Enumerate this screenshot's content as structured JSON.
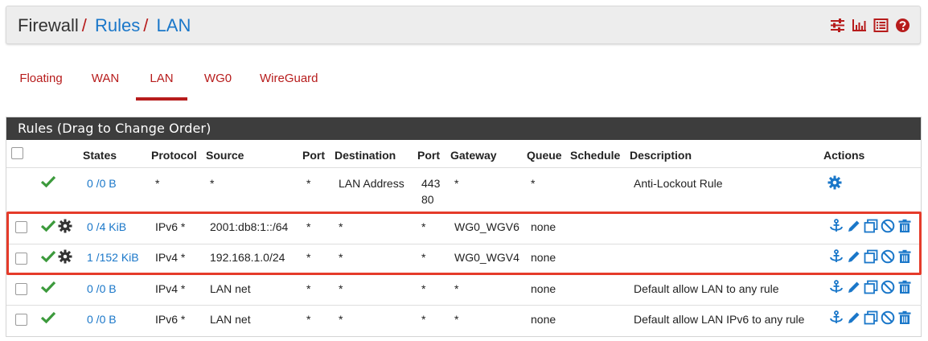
{
  "breadcrumb": {
    "item1": "Firewall",
    "sep1": "/",
    "item2": "Rules",
    "sep2": "/",
    "item3": "LAN"
  },
  "header_icons": [
    "sliders-icon",
    "bar-chart-icon",
    "list-icon",
    "help-icon"
  ],
  "tabs": [
    {
      "label": "Floating"
    },
    {
      "label": "WAN"
    },
    {
      "label": "LAN",
      "active": true
    },
    {
      "label": "WG0"
    },
    {
      "label": "WireGuard"
    }
  ],
  "panel": {
    "heading": "Rules (Drag to Change Order)"
  },
  "columns": {
    "states": "States",
    "protocol": "Protocol",
    "source": "Source",
    "port": "Port",
    "destination": "Destination",
    "port2": "Port",
    "gateway": "Gateway",
    "queue": "Queue",
    "schedule": "Schedule",
    "description": "Description",
    "actions": "Actions"
  },
  "rows": [
    {
      "states": "0 /0 B",
      "protocol": "*",
      "source": "*",
      "port": "*",
      "destination": "LAN Address",
      "port2_line1": "443",
      "port2_line2": "80",
      "gateway": "*",
      "queue": "*",
      "schedule": "",
      "description": "Anti-Lockout Rule"
    },
    {
      "states": "0 /4 KiB",
      "protocol": "IPv6 *",
      "source": "2001:db8:1::/64",
      "port": "*",
      "destination": "*",
      "port2": "*",
      "gateway": "WG0_WGV6",
      "queue": "none",
      "schedule": "",
      "description": ""
    },
    {
      "states": "1 /152 KiB",
      "protocol": "IPv4 *",
      "source": "192.168.1.0/24",
      "port": "*",
      "destination": "*",
      "port2": "*",
      "gateway": "WG0_WGV4",
      "queue": "none",
      "schedule": "",
      "description": ""
    },
    {
      "states": "0 /0 B",
      "protocol": "IPv4 *",
      "source": "LAN net",
      "port": "*",
      "destination": "*",
      "port2": "*",
      "gateway": "*",
      "queue": "none",
      "schedule": "",
      "description": "Default allow LAN to any rule"
    },
    {
      "states": "0 /0 B",
      "protocol": "IPv6 *",
      "source": "LAN net",
      "port": "*",
      "destination": "*",
      "port2": "*",
      "gateway": "*",
      "queue": "none",
      "schedule": "",
      "description": "Default allow LAN IPv6 to any rule"
    }
  ],
  "colors": {
    "accent_red": "#b71c1c",
    "link_blue": "#1a77c9",
    "check_green": "#3c9a3c",
    "highlight_red": "#e53b2a"
  }
}
